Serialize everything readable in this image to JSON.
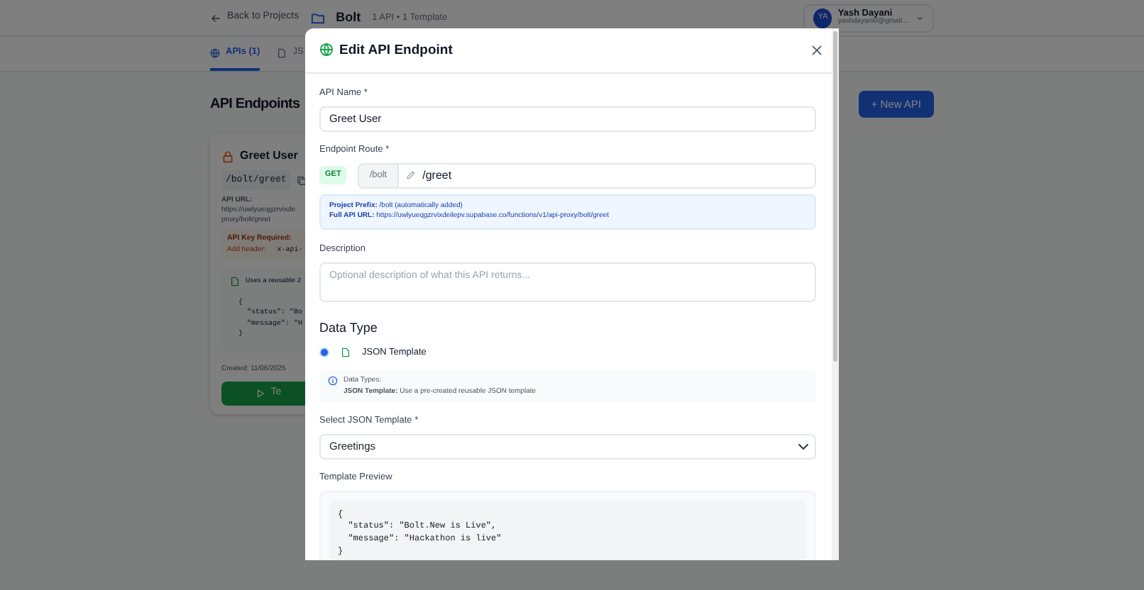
{
  "header": {
    "back_link": "Back to Projects",
    "project_name": "Bolt",
    "project_meta": "1 API • 1 Template",
    "user": {
      "initials": "YA",
      "name": "Yash Dayani",
      "email": "yashdayani0@gmail...."
    }
  },
  "tabs": [
    {
      "label": "APIs (1)",
      "selected": true
    },
    {
      "label": "JS",
      "selected": false
    }
  ],
  "page_title": "API Endpoints",
  "new_button": "+ New API",
  "endpoint_card": {
    "name": "Greet User",
    "route": "/bolt/greet",
    "url_label": "API URL:",
    "url_lines": [
      "https://uwlyueqgzrvixde",
      "proxy/bolt/greet"
    ],
    "key_title": "API Key Required:",
    "key_label": "Add header:",
    "key_value": "x-api-",
    "template_note": "Uses a reusable J",
    "code": "{\n  \"status\": \"Bo\n  \"message\": \"H\n}",
    "created": "Created: 11/06/2025",
    "test_button": "Te"
  },
  "modal": {
    "title": "Edit API Endpoint",
    "name_label": "API Name *",
    "name_value": "Greet User",
    "route_label": "Endpoint Route *",
    "method": "GET",
    "prefix": "/bolt",
    "route_value": "/greet",
    "info_lines": [
      "**Project Prefix:** /bolt (automatically added)",
      "**Full API URL:** https://uwlyueqgzrvixdeilepv.supabase.co/functions/v1/api-proxy/bolt/greet"
    ],
    "description_label": "Description",
    "description_placeholder": "Optional description of what this API returns...",
    "data_type_heading": "Data Type",
    "data_type_options": [
      {
        "label": "JSON Template",
        "selected": true
      }
    ],
    "data_types_note": {
      "title": "Data Types:",
      "text": "**JSON Template:** Use a pre-created reusable JSON template"
    },
    "template_label": "Select JSON Template *",
    "template_value": "Greetings",
    "preview_label": "Template Preview",
    "preview_code": "{\n  \"status\": \"Bolt.New is Live\",\n  \"message\": \"Hackathon is live\"\n}"
  }
}
